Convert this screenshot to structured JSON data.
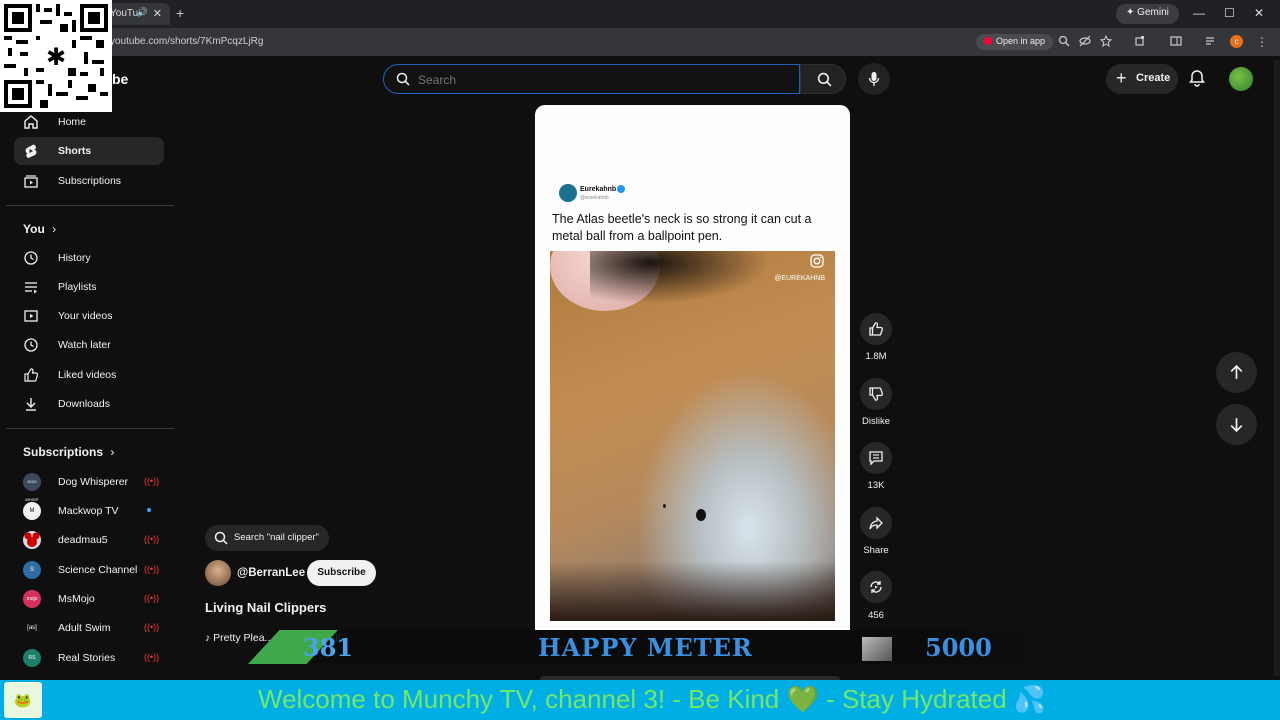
{
  "browser": {
    "tab_title": "YouTu",
    "url": "youtube.com/shorts/7KmPcqzLjRg",
    "gemini_label": "Gemini",
    "open_in_app_label": "Open in app",
    "profile_initial": "c",
    "new_tab_label": "+",
    "tab_close_label": "✕",
    "minimize_label": "—",
    "maximize_label": "☐",
    "close_label": "✕"
  },
  "header": {
    "logo_text": "be",
    "search_placeholder": "Search",
    "create_label": "Create"
  },
  "sidebar": {
    "main": [
      {
        "label": "Home",
        "icon": "home-icon"
      },
      {
        "label": "Shorts",
        "icon": "shorts-icon",
        "active": true
      },
      {
        "label": "Subscriptions",
        "icon": "subscriptions-icon"
      }
    ],
    "you_heading": "You",
    "you_items": [
      {
        "label": "History",
        "icon": "history-icon"
      },
      {
        "label": "Playlists",
        "icon": "playlists-icon"
      },
      {
        "label": "Your videos",
        "icon": "your-videos-icon"
      },
      {
        "label": "Watch later",
        "icon": "watch-later-icon"
      },
      {
        "label": "Liked videos",
        "icon": "liked-videos-icon"
      },
      {
        "label": "Downloads",
        "icon": "downloads-icon"
      }
    ],
    "subs_heading": "Subscriptions",
    "subs": [
      {
        "label": "Dog Whisperer",
        "status": "live",
        "avatar_text": "DOG WHISP.",
        "color": "#3b4a5a"
      },
      {
        "label": "Mackwop TV",
        "status": "new",
        "avatar_text": "M",
        "color": "#f2f2f2"
      },
      {
        "label": "deadmau5",
        "status": "live",
        "avatar_text": "",
        "color": "#d9d9d9"
      },
      {
        "label": "Science Channel",
        "status": "live",
        "avatar_text": "S",
        "color": "#2f6ea5"
      },
      {
        "label": "MsMojo",
        "status": "live",
        "avatar_text": "mojo",
        "color": "#d6305c"
      },
      {
        "label": "Adult Swim",
        "status": "live",
        "avatar_text": "[as]",
        "color": "#111111"
      },
      {
        "label": "Real Stories",
        "status": "live",
        "avatar_text": "RS",
        "color": "#1d7f6b"
      }
    ]
  },
  "video": {
    "tweet_name": "Eurekahnb",
    "tweet_handle": "@eurekahnb",
    "tweet_text": "The Atlas beetle's neck is so strong it can cut a metal ball from a ballpoint pen.",
    "watermark": "@EUREKAHNB"
  },
  "actions": {
    "likes": "1.8M",
    "dislike_label": "Dislike",
    "comments": "13K",
    "share_label": "Share",
    "remix_count": "456"
  },
  "info": {
    "search_suggestion": "Search \"nail clipper\"",
    "channel_name": "@BerranLee",
    "subscribe_label": "Subscribe",
    "title": "Living Nail Clippers",
    "music": "Pretty Plea... SIDE BOOGIE x Berran Lee x Steff Mar"
  },
  "overlay": {
    "meter_value": "381",
    "meter_label": "HAPPY METER",
    "meter_max": "5000",
    "ticker": "Welcome to Munchy TV, channel 3!  - Be Kind 💚  - Stay Hydrated 💦"
  },
  "colors": {
    "accent_blue": "#1c62b9",
    "live_red": "#ff3b3b",
    "ticker_bg": "#00aee6",
    "ticker_text": "#74e866"
  }
}
